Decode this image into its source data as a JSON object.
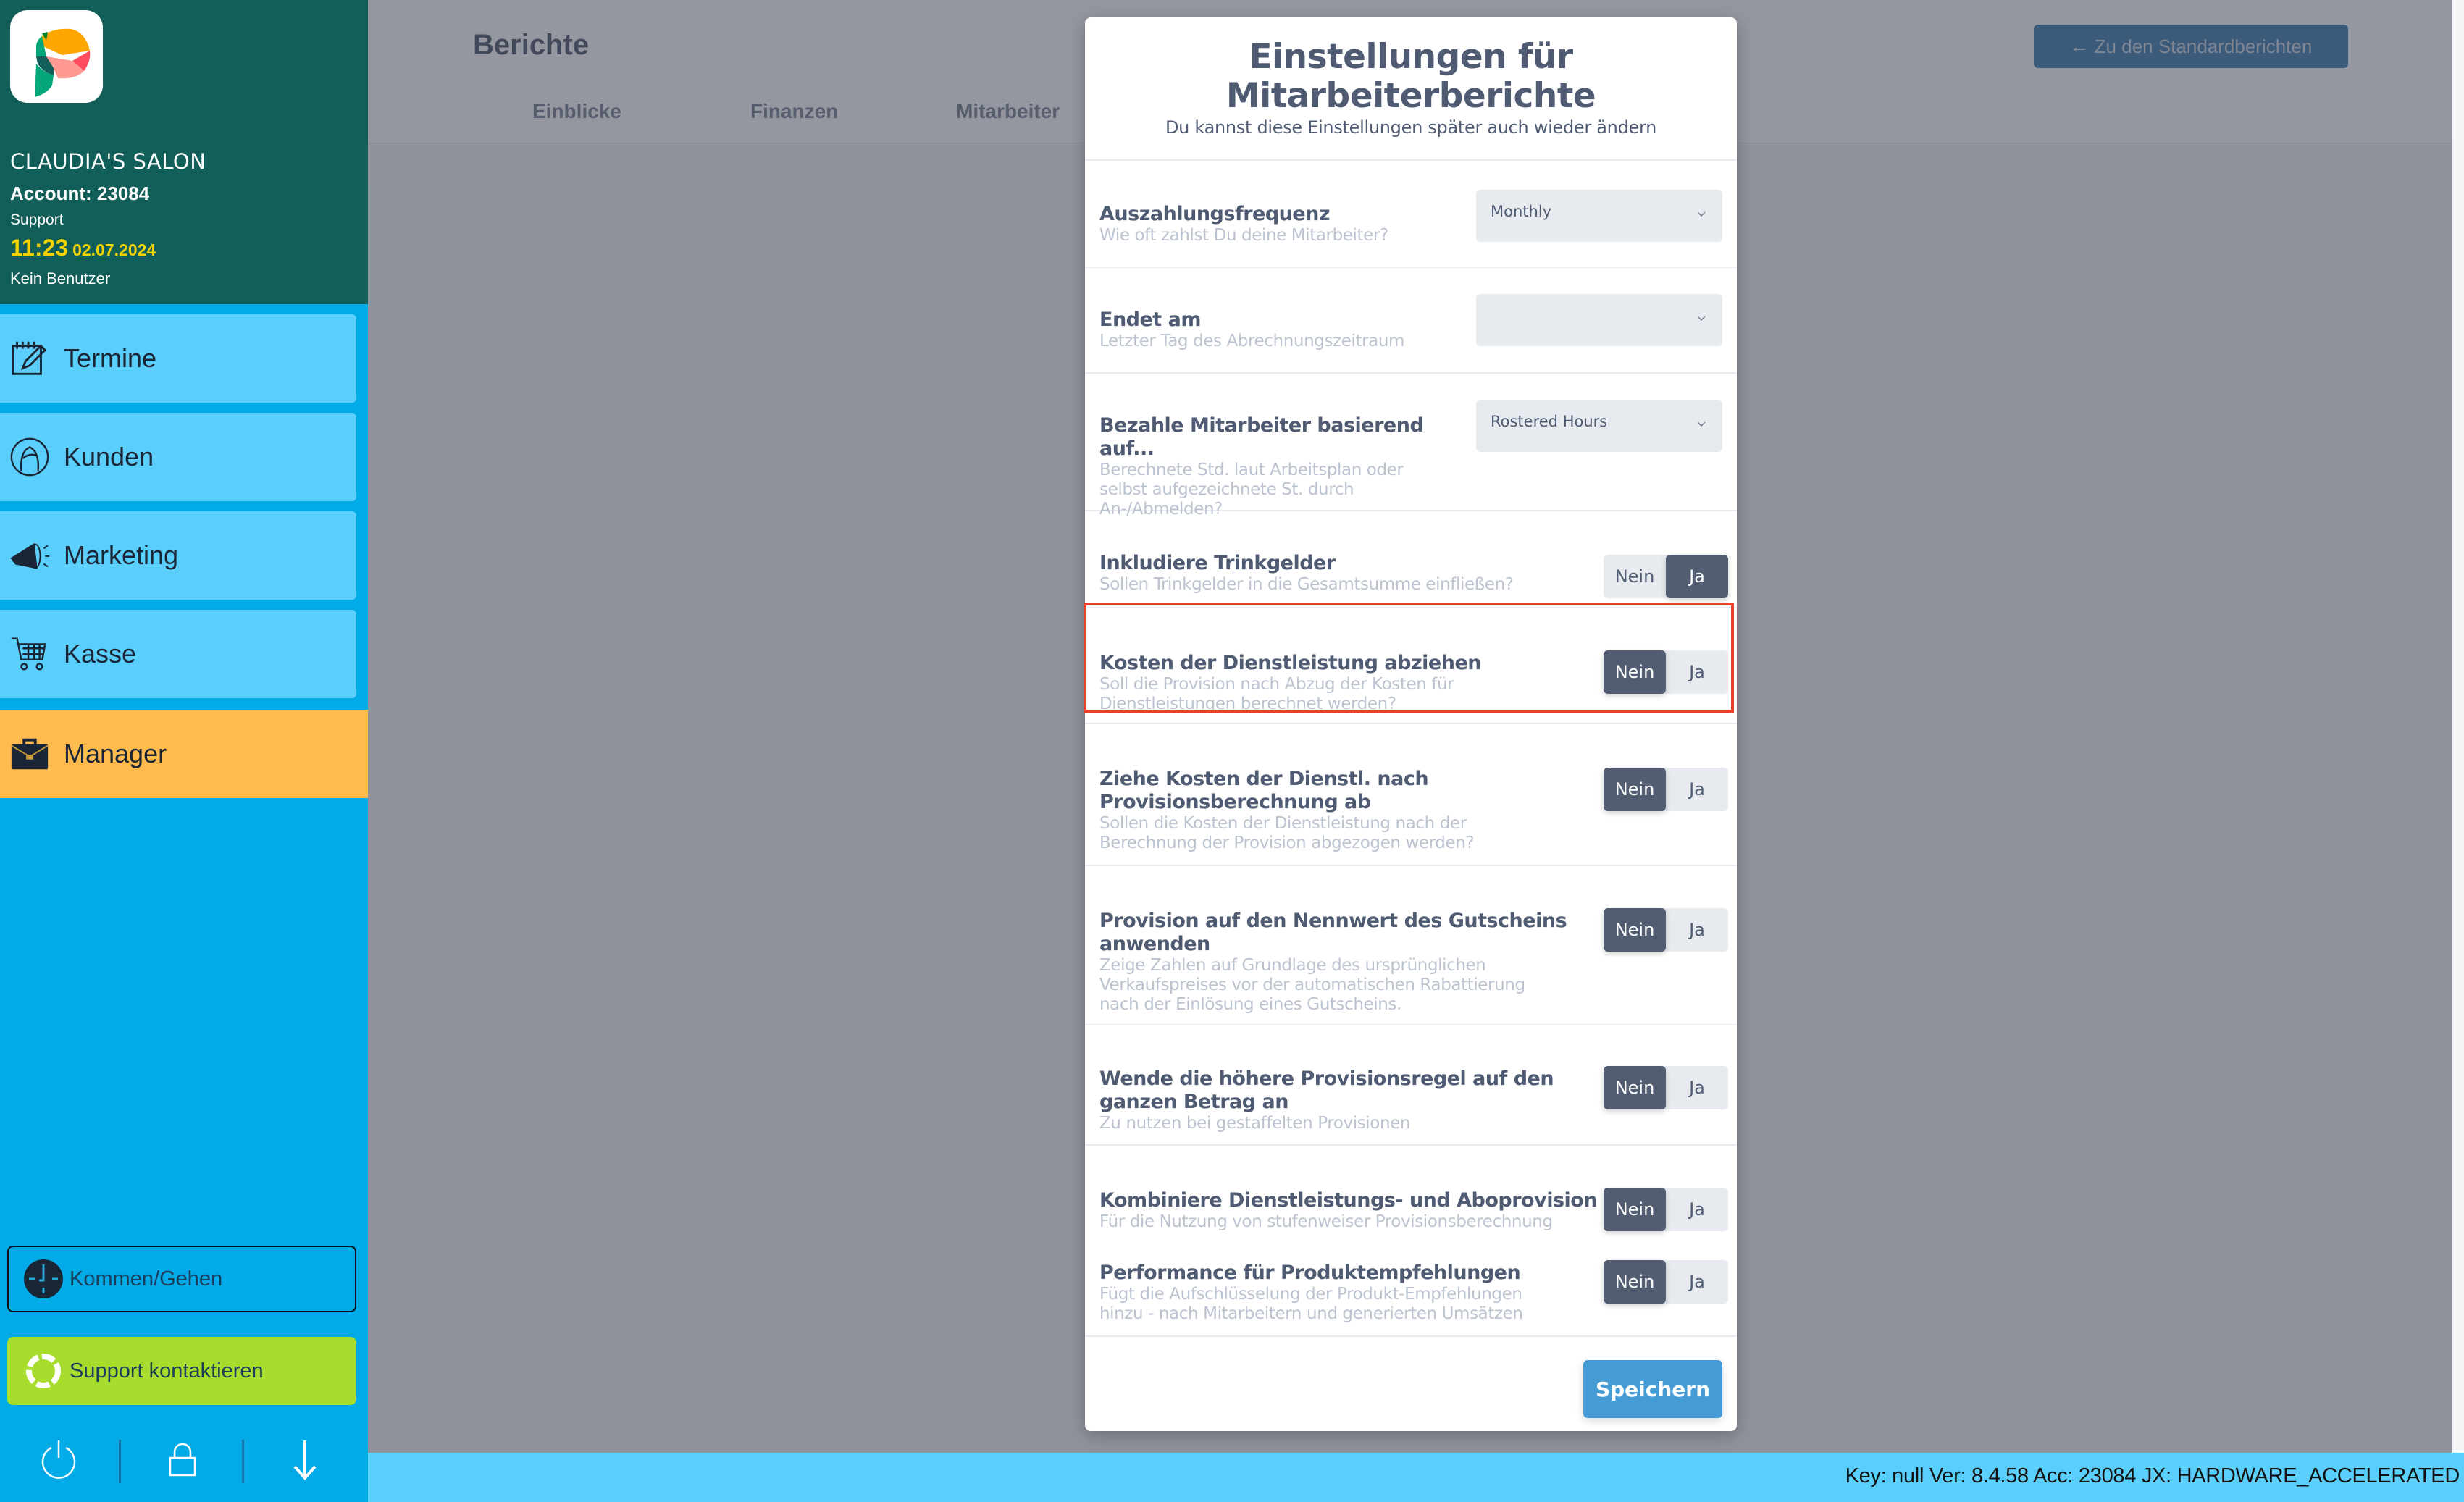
{
  "sidebar": {
    "salon_name": "CLAUDIA'S SALON",
    "account": "Account: 23084",
    "role": "Support",
    "time": "11:23",
    "date": "02.07.2024",
    "user": "Kein Benutzer",
    "nav": [
      {
        "label": "Termine",
        "icon": "calendar-edit-icon"
      },
      {
        "label": "Kunden",
        "icon": "customer-icon"
      },
      {
        "label": "Marketing",
        "icon": "megaphone-icon"
      },
      {
        "label": "Kasse",
        "icon": "cart-icon"
      },
      {
        "label": "Manager",
        "icon": "briefcase-icon",
        "active": true
      }
    ],
    "clock_button": "Kommen/Gehen",
    "support_button": "Support kontaktieren",
    "bottom_icons": [
      "power-icon",
      "lock-icon",
      "arrow-down-icon"
    ]
  },
  "page": {
    "title": "Berichte",
    "tabs": [
      "Einblicke",
      "Finanzen",
      "Mitarbeiter"
    ],
    "back_button": "Zu den Standardberichten"
  },
  "modal": {
    "title_line1": "Einstellungen für",
    "title_line2": "Mitarbeiterberichte",
    "subtitle": "Du kannst diese Einstellungen später auch wieder ändern",
    "settings": [
      {
        "title": "Auszahlungsfrequenz",
        "desc": [
          "Wie oft zahlst Du deine Mitarbeiter?"
        ],
        "type": "select",
        "value": "Monthly"
      },
      {
        "title": "Endet am",
        "desc": [
          "Letzter Tag des Abrechnungszeitraum"
        ],
        "type": "select",
        "value": ""
      },
      {
        "title": "Bezahle Mitarbeiter basierend auf...",
        "desc": [
          "Berechnete Std. laut Arbeitsplan oder",
          "selbst aufgezeichnete St. durch",
          "An-/Abmelden?"
        ],
        "type": "select",
        "value": "Rostered Hours"
      },
      {
        "title": "Inkludiere Trinkgelder",
        "desc": [
          "Sollen Trinkgelder in die Gesamtsumme einfließen?"
        ],
        "type": "toggle",
        "value": "Ja"
      },
      {
        "title": "Kosten der Dienstleistung abziehen",
        "desc": [
          "Soll die Provision nach Abzug der Kosten für",
          "Dienstleistungen berechnet werden?"
        ],
        "type": "toggle",
        "value": "Nein",
        "highlighted": true
      },
      {
        "title": "Ziehe Kosten der Dienstl. nach",
        "title2": "Provisionsberechnung ab",
        "desc": [
          "Sollen die Kosten der Dienstleistung nach der",
          "Berechnung der Provision abgezogen werden?"
        ],
        "type": "toggle",
        "value": "Nein"
      },
      {
        "title": "Provision auf den Nennwert des Gutscheins",
        "title2": "anwenden",
        "desc": [
          "Zeige Zahlen auf Grundlage des ursprünglichen",
          "Verkaufspreises vor der automatischen Rabattierung",
          "nach der Einlösung eines Gutscheins."
        ],
        "type": "toggle",
        "value": "Nein"
      },
      {
        "title": "Wende die höhere Provisionsregel auf den",
        "title2": "ganzen Betrag an",
        "desc": [
          "Zu nutzen bei gestaffelten Provisionen"
        ],
        "type": "toggle",
        "value": "Nein"
      },
      {
        "title": "Kombiniere Dienstleistungs- und Aboprovision",
        "desc": [
          "Für die Nutzung von stufenweiser Provisionsberechnung"
        ],
        "type": "toggle",
        "value": "Nein"
      },
      {
        "title": "Performance für Produktempfehlungen",
        "desc": [
          "Fügt die Aufschlüsselung der Produkt-Empfehlungen",
          "hinzu - nach Mitarbeitern und generierten Umsätzen"
        ],
        "type": "toggle",
        "value": "Nein"
      }
    ],
    "toggle_labels": {
      "no": "Nein",
      "yes": "Ja"
    },
    "save_button": "Speichern"
  },
  "status_bar": {
    "text": "Key: null Ver: 8.4.58 Acc: 23084  JX: HARDWARE_ACCELERATED"
  },
  "colors": {
    "sidebar_header": "#125e59",
    "sidebar_bg": "#02aae8",
    "nav_item": "#5bcffb",
    "nav_active": "#ffbb4d",
    "support_button": "#a8dc2d",
    "time_color": "#f2d200",
    "toggle_active": "#525d72",
    "save_button": "#459bd4",
    "highlight_border": "#e8402a"
  }
}
